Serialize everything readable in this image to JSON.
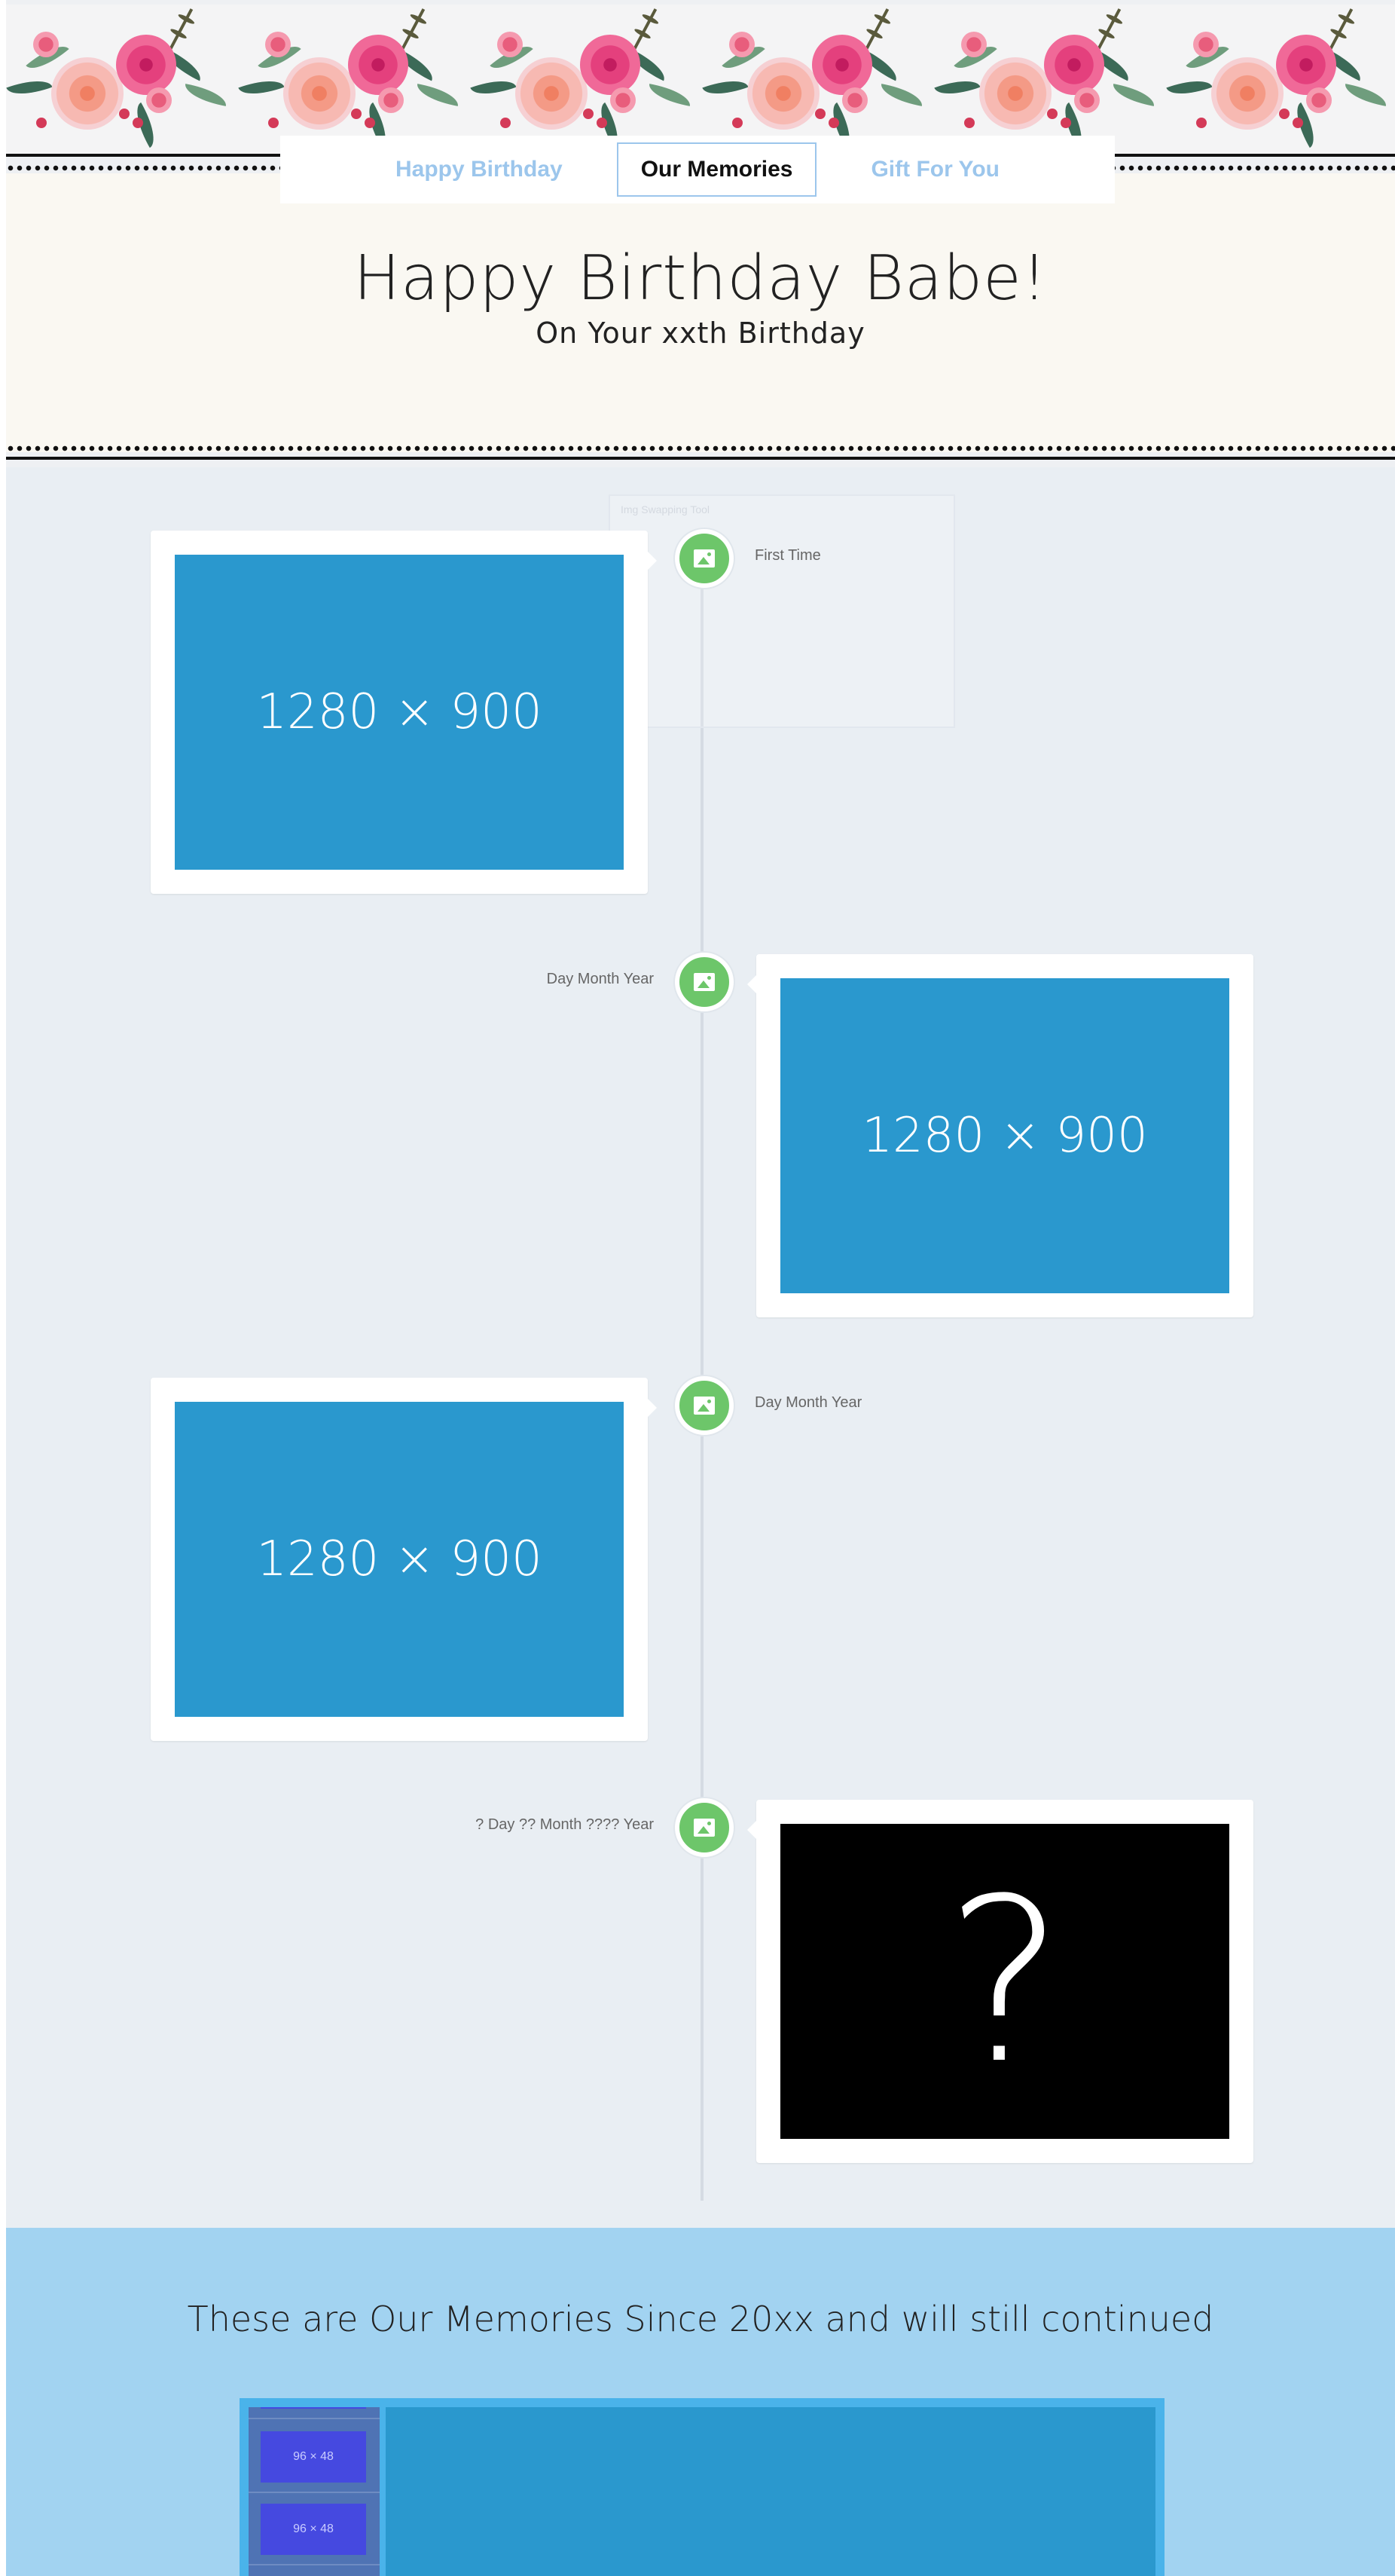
{
  "nav": {
    "items": [
      {
        "label": "Happy Birthday",
        "active": false
      },
      {
        "label": "Our Memories",
        "active": true
      },
      {
        "label": "Gift For You",
        "active": false
      }
    ]
  },
  "header": {
    "title": "Happy Birthday Babe!",
    "subtitle": "On Your xxth Birthday"
  },
  "timeline": {
    "ghost_text": "Img Swapping Tool",
    "events": [
      {
        "date": "First Time",
        "image": "1280 × 900"
      },
      {
        "date": "Day Month Year",
        "image": "1280 × 900"
      },
      {
        "date": "Day Month Year",
        "image": "1280 × 900"
      },
      {
        "date": "? Day ?? Month ???? Year",
        "image": "?"
      }
    ]
  },
  "memories": {
    "title": "These are Our Memories Since 20xx and will still continued",
    "thumbs": [
      "96 × 48",
      "96 × 48"
    ]
  },
  "colors": {
    "accent": "#9cc6ec",
    "timeline_dot": "#6dc66a",
    "placeholder": "#2a98ce",
    "memories_bg": "#a2d3f1"
  }
}
